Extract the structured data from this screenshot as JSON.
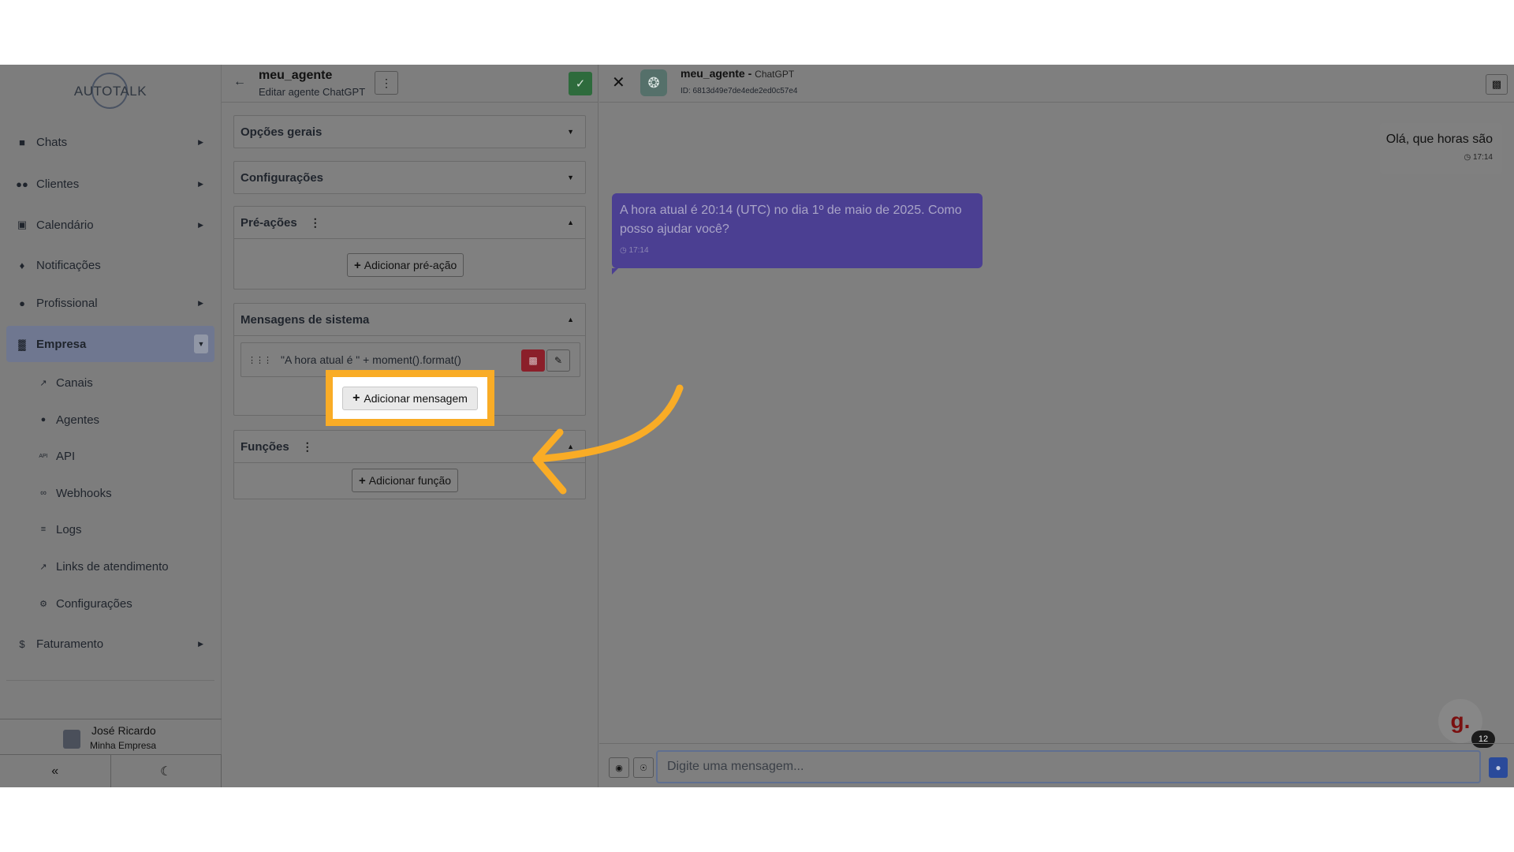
{
  "sidebar": {
    "logo_text": "AUTOTALK",
    "items": [
      {
        "label": "Chats",
        "icon": "chat-icon"
      },
      {
        "label": "Clientes",
        "icon": "users-icon"
      },
      {
        "label": "Calendário",
        "icon": "calendar-icon"
      },
      {
        "label": "Notificações",
        "icon": "bell-icon"
      },
      {
        "label": "Profissional",
        "icon": "user-tie-icon"
      },
      {
        "label": "Empresa",
        "icon": "building-icon"
      },
      {
        "label": "Faturamento",
        "icon": "dollar-icon"
      }
    ],
    "sub_items": [
      {
        "label": "Canais",
        "icon": "link-icon"
      },
      {
        "label": "Agentes",
        "icon": "robot-icon"
      },
      {
        "label": "API",
        "icon": "api-icon"
      },
      {
        "label": "Webhooks",
        "icon": "webhook-icon"
      },
      {
        "label": "Logs",
        "icon": "list-icon"
      },
      {
        "label": "Links de atendimento",
        "icon": "external-link-icon"
      },
      {
        "label": "Configurações",
        "icon": "gear-icon"
      }
    ],
    "user": {
      "name": "José Ricardo",
      "company": "Minha Empresa"
    }
  },
  "editor": {
    "title": "meu_agente",
    "subtitle": "Editar agente ChatGPT",
    "sections": {
      "general": "Opções gerais",
      "config": "Configurações",
      "pre_actions": "Pré-ações",
      "system_messages": "Mensagens de sistema",
      "functions": "Funções"
    },
    "add_pre_action": "Adicionar pré-ação",
    "system_message_text": "\"A hora atual é \" + moment().format()",
    "add_message": "Adicionar mensagem",
    "add_function": "Adicionar função"
  },
  "chat": {
    "agent_name": "meu_agente",
    "agent_model": "ChatGPT",
    "agent_id": "ID: 6813d49e7de4ede2ed0c57e4",
    "messages": [
      {
        "from": "user",
        "text": "Olá, que horas são",
        "time": "17:14"
      },
      {
        "from": "bot",
        "text": "A hora atual é 20:14 (UTC) no dia 1º de maio de 2025. Como posso ajudar você?",
        "time": "17:14"
      }
    ],
    "input_placeholder": "Digite uma mensagem...",
    "fab_letter": "g.",
    "fab_badge": "12"
  },
  "colors": {
    "highlight": "#f9ac26",
    "bot_bubble": "#4b3f92",
    "confirm": "#2e6b3c",
    "delete": "#8b1f2a"
  }
}
